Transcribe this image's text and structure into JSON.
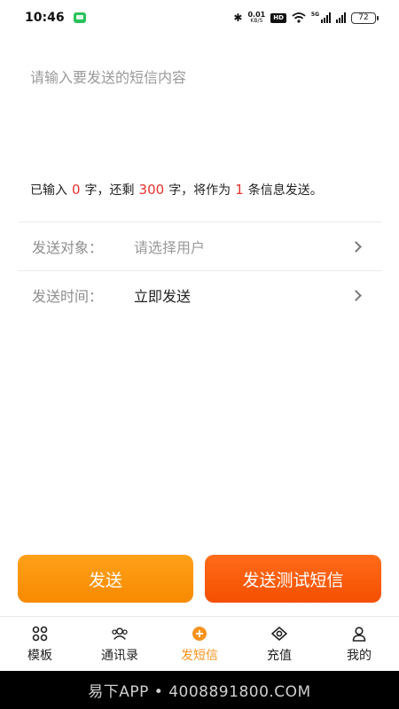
{
  "status_bar": {
    "time": "10:46",
    "net_speed_value": "0.01",
    "net_speed_unit": "KB/S",
    "hd_label": "HD",
    "signal_label": "5G",
    "battery": "72"
  },
  "compose": {
    "placeholder": "请输入要发送的短信内容",
    "value": ""
  },
  "counter": {
    "prefix": "已输入",
    "typed": "0",
    "mid1": "字，还剩",
    "remaining": "300",
    "mid2": "字，将作为",
    "count": "1",
    "suffix": "条信息发送。"
  },
  "rows": {
    "recipient": {
      "label": "发送对象：",
      "value": "请选择用户"
    },
    "time": {
      "label": "发送时间：",
      "value": "立即发送"
    }
  },
  "buttons": {
    "send": "发送",
    "send_test": "发送测试短信"
  },
  "tabs": [
    {
      "label": "模板",
      "icon": "grid-icon",
      "active": false
    },
    {
      "label": "通讯录",
      "icon": "contacts-icon",
      "active": false
    },
    {
      "label": "发短信",
      "icon": "add-circle-icon",
      "active": true
    },
    {
      "label": "充值",
      "icon": "recharge-icon",
      "active": false
    },
    {
      "label": "我的",
      "icon": "user-icon",
      "active": false
    }
  ],
  "watermark": "易下APP • 4008891800.COM",
  "colors": {
    "accent": "#f7931e",
    "send_button": "#f78a00",
    "test_button": "#f45000",
    "highlight_number": "#e5322d"
  }
}
